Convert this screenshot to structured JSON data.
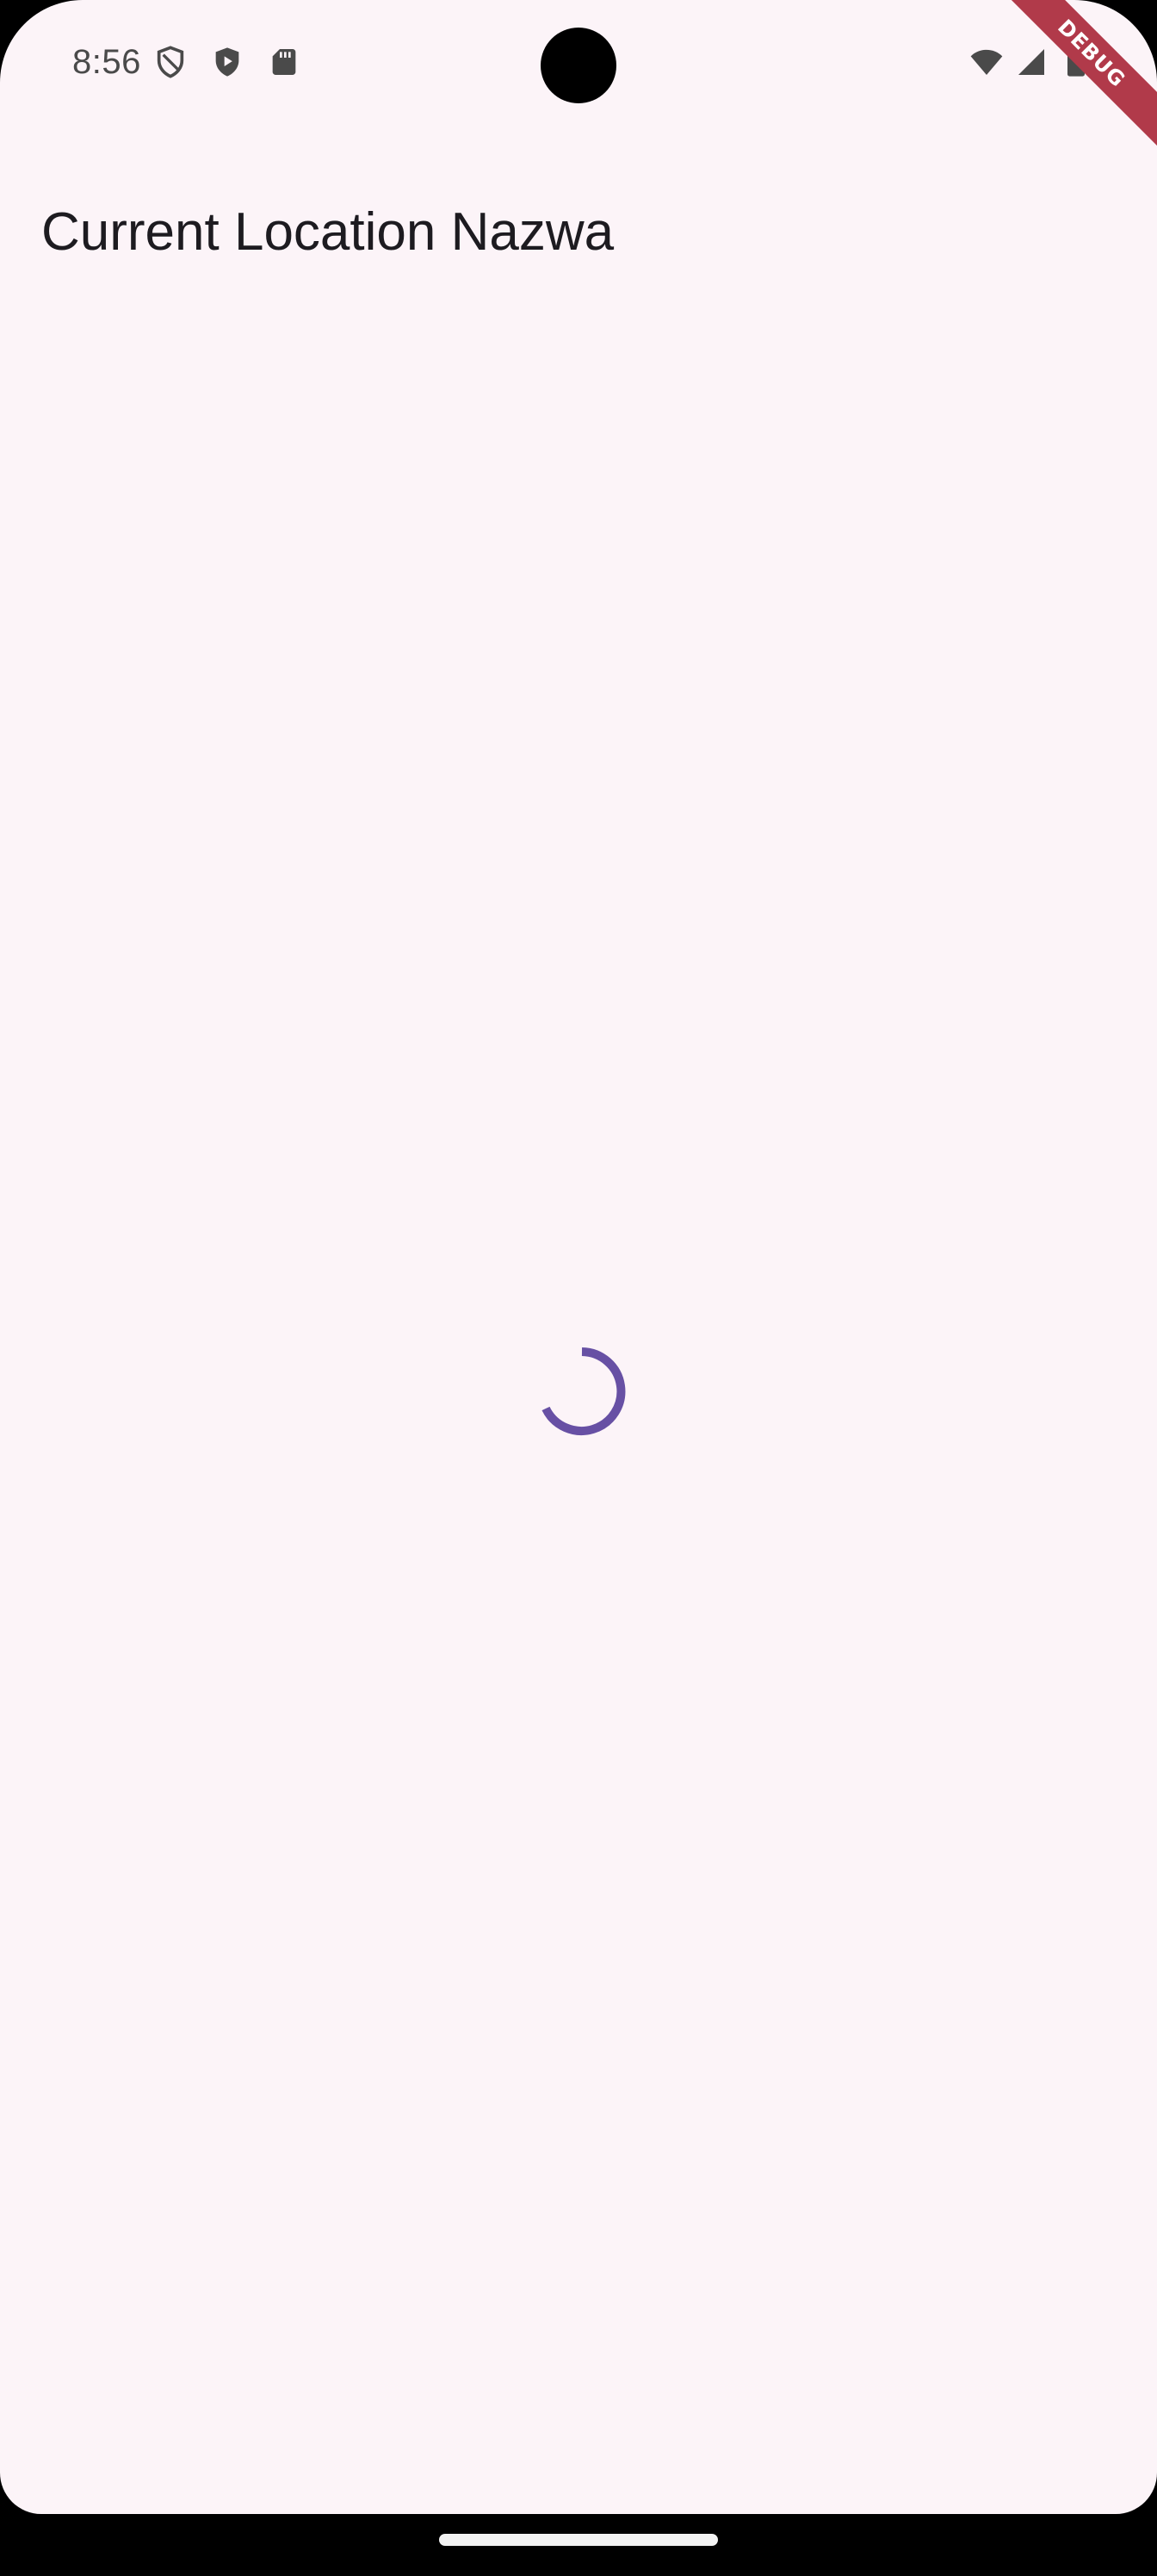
{
  "status_bar": {
    "time": "8:56",
    "left_icons": [
      "shield-outline-icon",
      "shield-play-icon",
      "sd-card-icon"
    ],
    "right_icons": [
      "wifi-icon",
      "signal-icon",
      "battery-icon"
    ]
  },
  "debug_banner": {
    "label": "DEBUG",
    "color": "#b13a4a"
  },
  "app_bar": {
    "title": "Current Location Nazwa"
  },
  "body": {
    "loading": true,
    "spinner_color": "#6750a4"
  },
  "colors": {
    "background": "#fcf4f8",
    "title_text": "#1d1b20"
  }
}
